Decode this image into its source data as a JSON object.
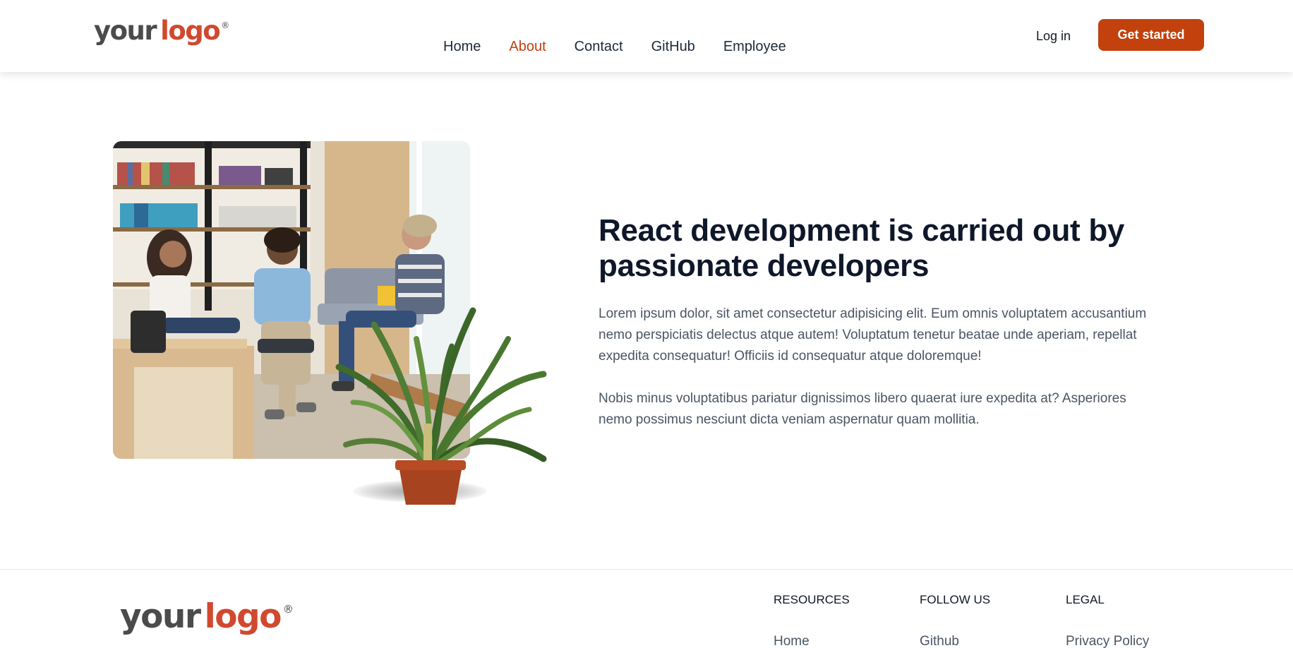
{
  "brand": {
    "logo_word1": "your",
    "logo_word2": "logo",
    "logo_mark": "®"
  },
  "nav": {
    "items": [
      {
        "label": "Home",
        "active": false
      },
      {
        "label": "About",
        "active": true
      },
      {
        "label": "Contact",
        "active": false
      },
      {
        "label": "GitHub",
        "active": false
      },
      {
        "label": "Employee",
        "active": false
      }
    ]
  },
  "header_actions": {
    "login": "Log in",
    "get_started": "Get started"
  },
  "about": {
    "headline": "React development is carried out by passionate developers",
    "paragraph1": "Lorem ipsum dolor, sit amet consectetur adipisicing elit. Eum omnis voluptatem accusantium nemo perspiciatis delectus atque autem! Voluptatum tenetur beatae unde aperiam, repellat expedita consequatur! Officiis id consequatur atque doloremque!",
    "paragraph2": "Nobis minus voluptatibus pariatur dignissimos libero quaerat iure expedita at? Asperiores nemo possimus nesciunt dicta veniam aspernatur quam mollitia."
  },
  "footer": {
    "columns": [
      {
        "heading": "RESOURCES",
        "links": [
          "Home"
        ]
      },
      {
        "heading": "FOLLOW US",
        "links": [
          "Github"
        ]
      },
      {
        "heading": "LEGAL",
        "links": [
          "Privacy Policy"
        ]
      }
    ]
  },
  "colors": {
    "accent": "#c2410c",
    "logo_red": "#d0492f",
    "logo_gray": "#4b4b4b",
    "heading": "#0f172a",
    "body_text": "#4b5563"
  }
}
